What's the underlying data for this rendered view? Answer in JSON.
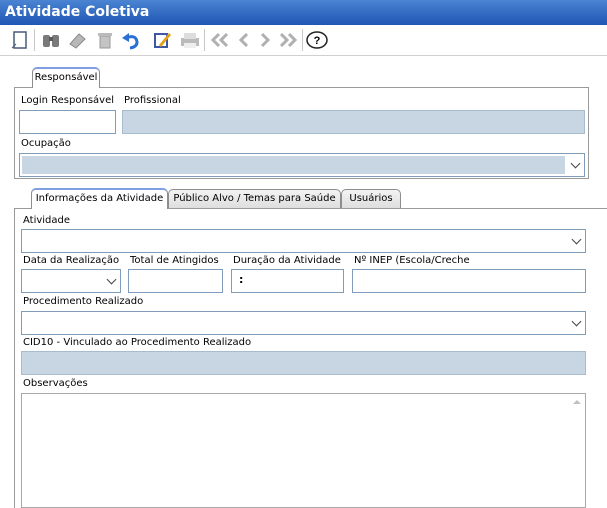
{
  "window": {
    "title": "Atividade Coletiva"
  },
  "toolbar": {
    "buttons": [
      {
        "icon": "new-document-icon"
      },
      {
        "icon": "binoculars-icon"
      },
      {
        "icon": "eraser-icon"
      },
      {
        "icon": "trash-icon"
      },
      {
        "icon": "undo-icon"
      },
      {
        "icon": "edit-icon"
      },
      {
        "icon": "print-icon"
      },
      {
        "icon": "first-icon"
      },
      {
        "icon": "previous-icon"
      },
      {
        "icon": "next-icon"
      },
      {
        "icon": "last-icon"
      },
      {
        "icon": "help-icon"
      }
    ]
  },
  "responsavel": {
    "tab_label": "Responsável",
    "login_label": "Login Responsável",
    "login_value": "",
    "profissional_label": "Profissional",
    "profissional_value": "",
    "ocupacao_label": "Ocupação",
    "ocupacao_value": ""
  },
  "tabs": [
    {
      "label": "Informações da Atividade",
      "active": true
    },
    {
      "label": "Público Alvo / Temas para Saúde",
      "active": false
    },
    {
      "label": "Usuários",
      "active": false
    }
  ],
  "atividade_form": {
    "atividade_label": "Atividade",
    "atividade_value": "",
    "data_label": "Data da Realização",
    "data_value": "",
    "total_label": "Total de Atingidos",
    "total_value": "",
    "duracao_label": "Duração da Atividade",
    "duracao_value": ":",
    "inep_label": "Nº INEP (Escola/Creche",
    "inep_value": "",
    "procedimento_label": "Procedimento Realizado",
    "procedimento_value": "",
    "cid_label": "CID10 - Vinculado ao Procedimento Realizado",
    "cid_value": "",
    "observacoes_label": "Observações",
    "observacoes_value": ""
  }
}
